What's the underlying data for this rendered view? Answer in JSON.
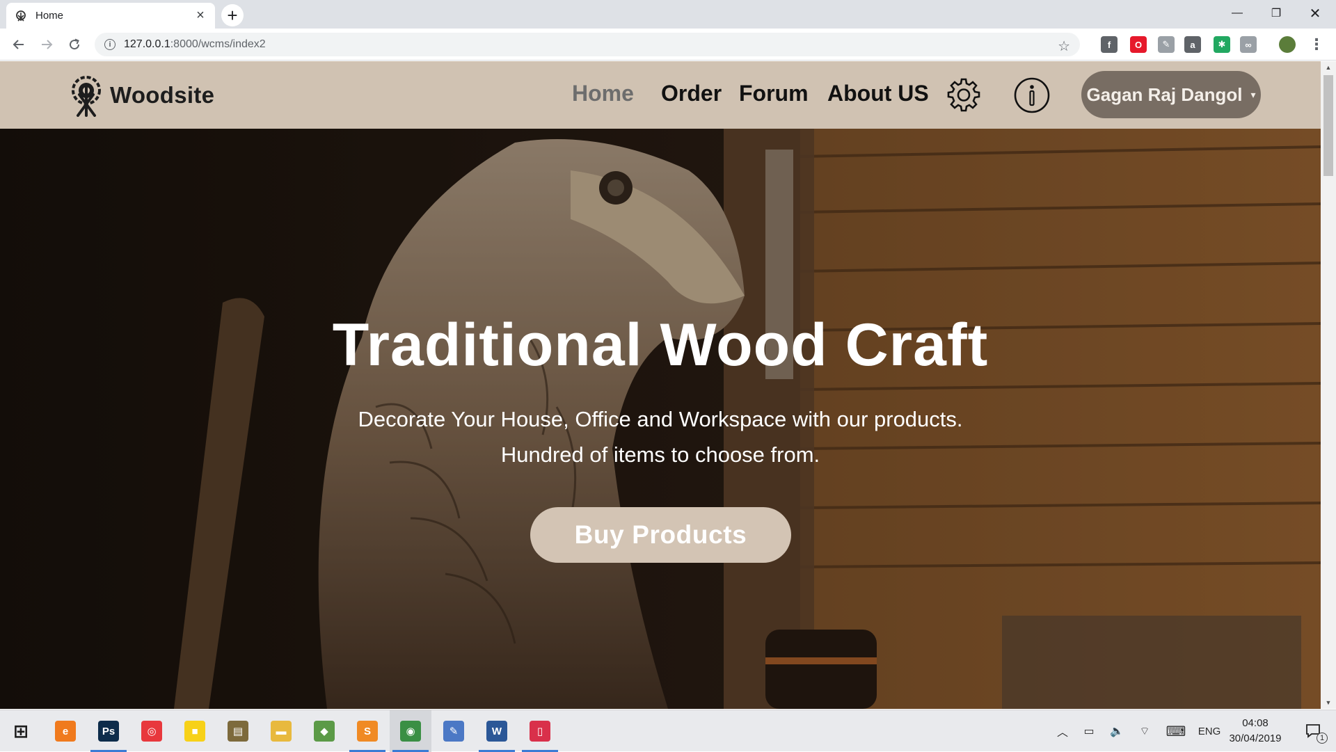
{
  "browser": {
    "tab": {
      "title": "Home",
      "close": "×"
    },
    "new_tab": "+",
    "window": {
      "minimize": "—",
      "maximize": "❐",
      "close": "✕"
    },
    "url": {
      "host": "127.0.0.1",
      "path": ":8000/wcms/index2"
    },
    "bookmark": "☆",
    "extensions": [
      {
        "name": "facebook-extension-icon",
        "label": "f",
        "color": "#5f6368"
      },
      {
        "name": "opera-extension-icon",
        "label": "O",
        "color": "#e6192b"
      },
      {
        "name": "pencil-extension-icon",
        "label": "✎",
        "color": "#9aa0a6"
      },
      {
        "name": "bag-extension-icon",
        "label": "a",
        "color": "#5f6368"
      },
      {
        "name": "puzzle-extension-icon",
        "label": "✱",
        "color": "#22a861"
      },
      {
        "name": "infinity-extension-icon",
        "label": "∞",
        "color": "#9aa0a6"
      }
    ],
    "menu": "⋮"
  },
  "site": {
    "brand": "Woodsite",
    "nav": [
      {
        "label": "Home",
        "active": true
      },
      {
        "label": "Order",
        "active": false
      },
      {
        "label": "Forum",
        "active": false
      },
      {
        "label": "About US",
        "active": false
      }
    ],
    "user": {
      "name": "Gagan Raj Dangol",
      "caret": "▾"
    }
  },
  "hero": {
    "title": "Traditional Wood Craft",
    "subtitle_line1": "Decorate Your House, Office and Workspace with our products.",
    "subtitle_line2": "Hundred of items to choose from.",
    "button": "Buy Products"
  },
  "taskbar": {
    "apps": [
      {
        "name": "start-button",
        "label": "⊞",
        "color": "#1c1c1c"
      },
      {
        "name": "edge-app",
        "label": "e",
        "color": "#f07a1d"
      },
      {
        "name": "photoshop-app",
        "label": "Ps",
        "color": "#0d2c4b"
      },
      {
        "name": "spiral-app",
        "label": "◎",
        "color": "#e8383d"
      },
      {
        "name": "sticky-notes-app",
        "label": "■",
        "color": "#f7d118"
      },
      {
        "name": "notes-app",
        "label": "▤",
        "color": "#7d6a3c"
      },
      {
        "name": "file-explorer-app",
        "label": "▬",
        "color": "#e8b93e"
      },
      {
        "name": "git-app",
        "label": "◆",
        "color": "#5b9a47"
      },
      {
        "name": "sublime-app",
        "label": "S",
        "color": "#f08a24"
      },
      {
        "name": "chrome-app",
        "label": "◉",
        "color": "#3a8f44"
      },
      {
        "name": "paint-app",
        "label": "✎",
        "color": "#4b78c5"
      },
      {
        "name": "word-app",
        "label": "W",
        "color": "#2b5797"
      },
      {
        "name": "phone-app",
        "label": "▯",
        "color": "#d9304a"
      }
    ],
    "tray": {
      "chevron": "︿",
      "battery": "▭",
      "volume": "🔈",
      "wifi": "⌔",
      "keyboard": "⌨",
      "language": "ENG",
      "notifications": "1"
    },
    "clock": {
      "time": "04:08",
      "date": "30/04/2019"
    }
  }
}
